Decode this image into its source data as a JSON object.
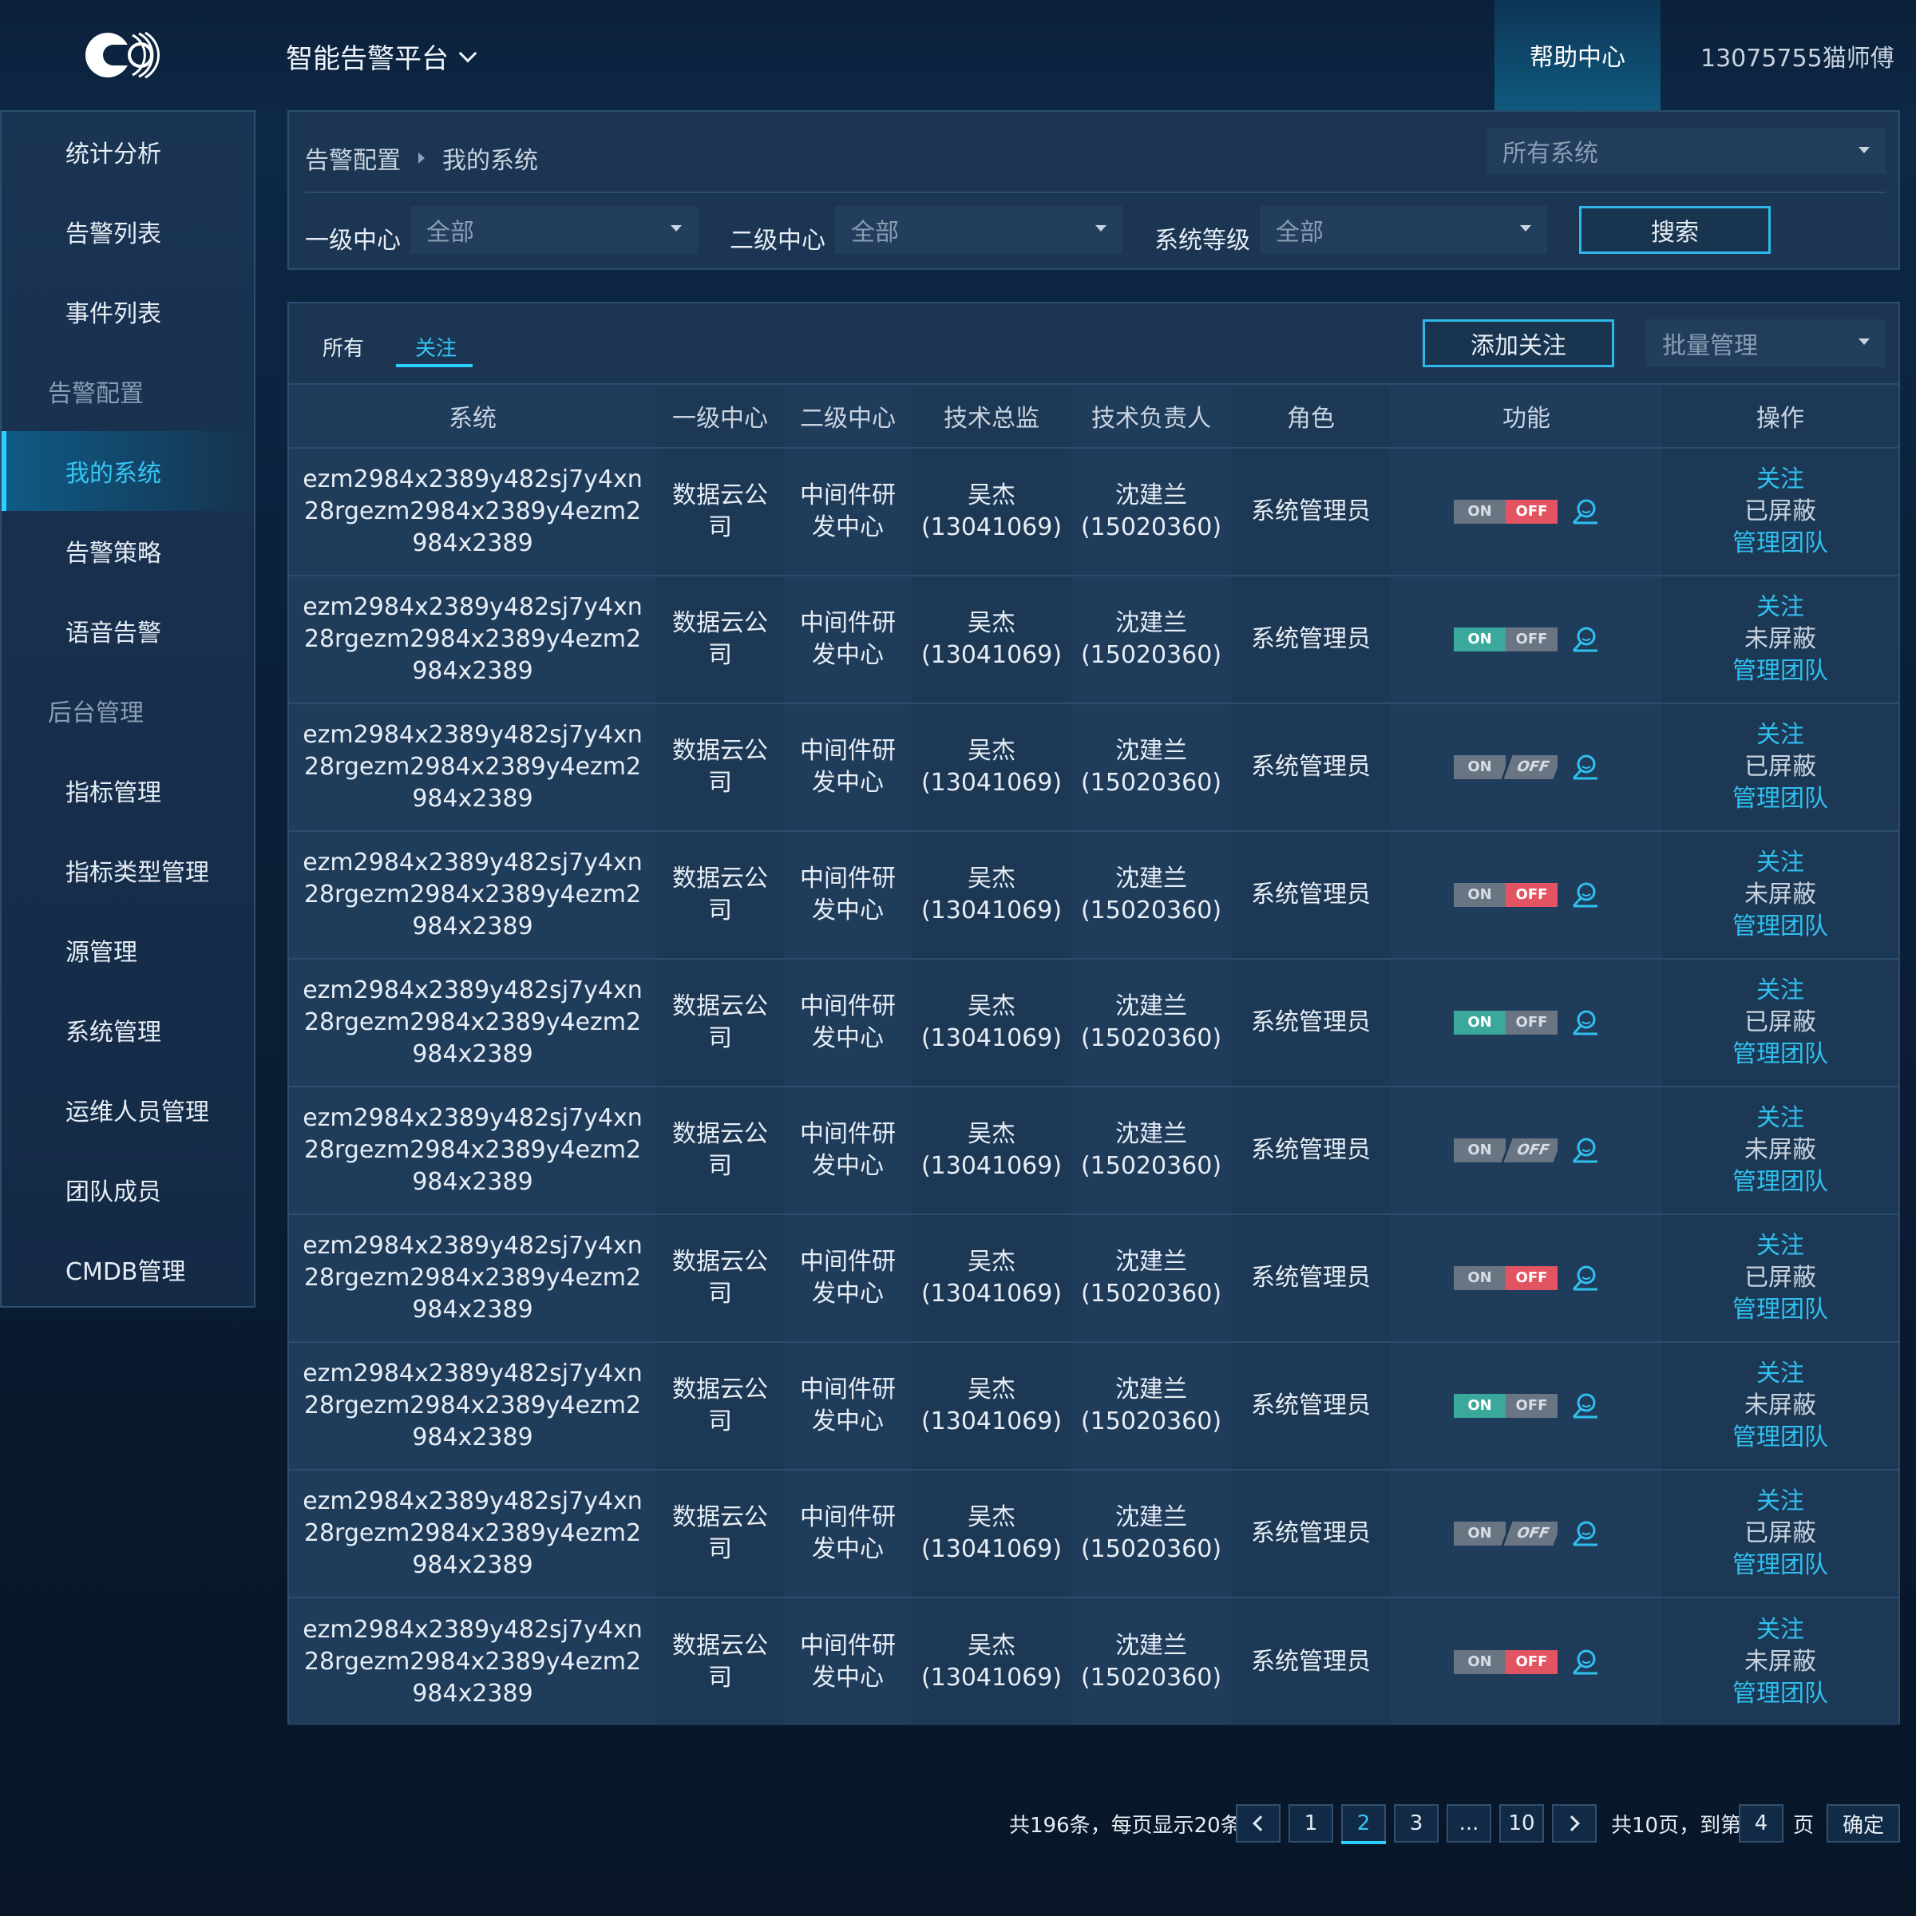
{
  "header": {
    "app_title": "智能告警平台",
    "help_label": "帮助中心",
    "user_label": "13075755猫师傅"
  },
  "sidebar": {
    "items": [
      {
        "label": "统计分析",
        "type": "item"
      },
      {
        "label": "告警列表",
        "type": "item"
      },
      {
        "label": "事件列表",
        "type": "item"
      },
      {
        "label": "告警配置",
        "type": "group"
      },
      {
        "label": "我的系统",
        "type": "item",
        "active": true
      },
      {
        "label": "告警策略",
        "type": "item"
      },
      {
        "label": "语音告警",
        "type": "item"
      },
      {
        "label": "后台管理",
        "type": "group"
      },
      {
        "label": "指标管理",
        "type": "item"
      },
      {
        "label": "指标类型管理",
        "type": "item"
      },
      {
        "label": "源管理",
        "type": "item"
      },
      {
        "label": "系统管理",
        "type": "item"
      },
      {
        "label": "运维人员管理",
        "type": "item"
      },
      {
        "label": "团队成员",
        "type": "item"
      },
      {
        "label": "CMDB管理",
        "type": "item"
      }
    ]
  },
  "breadcrumb": {
    "parent": "告警配置",
    "current": "我的系统"
  },
  "filters": {
    "system_select": "所有系统",
    "level1_label": "一级中心",
    "level1_value": "全部",
    "level2_label": "二级中心",
    "level2_value": "全部",
    "grade_label": "系统等级",
    "grade_value": "全部",
    "search_label": "搜索"
  },
  "tabs": {
    "all": "所有",
    "favorites": "关注"
  },
  "toolbar": {
    "add_label": "添加关注",
    "batch_label": "批量管理"
  },
  "table": {
    "columns": [
      "系统",
      "一级中心",
      "二级中心",
      "技术总监",
      "技术负责人",
      "角色",
      "功能",
      "操作"
    ],
    "rows": [
      {
        "system": "ezm2984x2389y482sj7y4xn28rgezm2984x2389y4ezm2984x2389",
        "l1": "数据云公司",
        "l2": "中间件研发中心",
        "director": "吴杰(13041069)",
        "owner": "沈建兰(15020360)",
        "role": "系统管理员",
        "toggle": "off",
        "op1": "关注",
        "op2": "已屏蔽",
        "op3": "管理团队"
      },
      {
        "system": "ezm2984x2389y482sj7y4xn28rgezm2984x2389y4ezm2984x2389",
        "l1": "数据云公司",
        "l2": "中间件研发中心",
        "director": "吴杰(13041069)",
        "owner": "沈建兰(15020360)",
        "role": "系统管理员",
        "toggle": "on",
        "op1": "关注",
        "op2": "未屏蔽",
        "op3": "管理团队"
      },
      {
        "system": "ezm2984x2389y482sj7y4xn28rgezm2984x2389y4ezm2984x2389",
        "l1": "数据云公司",
        "l2": "中间件研发中心",
        "director": "吴杰(13041069)",
        "owner": "沈建兰(15020360)",
        "role": "系统管理员",
        "toggle": "neutral",
        "op1": "关注",
        "op2": "已屏蔽",
        "op3": "管理团队"
      },
      {
        "system": "ezm2984x2389y482sj7y4xn28rgezm2984x2389y4ezm2984x2389",
        "l1": "数据云公司",
        "l2": "中间件研发中心",
        "director": "吴杰(13041069)",
        "owner": "沈建兰(15020360)",
        "role": "系统管理员",
        "toggle": "off",
        "op1": "关注",
        "op2": "未屏蔽",
        "op3": "管理团队"
      },
      {
        "system": "ezm2984x2389y482sj7y4xn28rgezm2984x2389y4ezm2984x2389",
        "l1": "数据云公司",
        "l2": "中间件研发中心",
        "director": "吴杰(13041069)",
        "owner": "沈建兰(15020360)",
        "role": "系统管理员",
        "toggle": "on",
        "op1": "关注",
        "op2": "已屏蔽",
        "op3": "管理团队"
      },
      {
        "system": "ezm2984x2389y482sj7y4xn28rgezm2984x2389y4ezm2984x2389",
        "l1": "数据云公司",
        "l2": "中间件研发中心",
        "director": "吴杰(13041069)",
        "owner": "沈建兰(15020360)",
        "role": "系统管理员",
        "toggle": "neutral",
        "op1": "关注",
        "op2": "未屏蔽",
        "op3": "管理团队"
      },
      {
        "system": "ezm2984x2389y482sj7y4xn28rgezm2984x2389y4ezm2984x2389",
        "l1": "数据云公司",
        "l2": "中间件研发中心",
        "director": "吴杰(13041069)",
        "owner": "沈建兰(15020360)",
        "role": "系统管理员",
        "toggle": "off",
        "op1": "关注",
        "op2": "已屏蔽",
        "op3": "管理团队"
      },
      {
        "system": "ezm2984x2389y482sj7y4xn28rgezm2984x2389y4ezm2984x2389",
        "l1": "数据云公司",
        "l2": "中间件研发中心",
        "director": "吴杰(13041069)",
        "owner": "沈建兰(15020360)",
        "role": "系统管理员",
        "toggle": "on",
        "op1": "关注",
        "op2": "未屏蔽",
        "op3": "管理团队"
      },
      {
        "system": "ezm2984x2389y482sj7y4xn28rgezm2984x2389y4ezm2984x2389",
        "l1": "数据云公司",
        "l2": "中间件研发中心",
        "director": "吴杰(13041069)",
        "owner": "沈建兰(15020360)",
        "role": "系统管理员",
        "toggle": "neutral",
        "op1": "关注",
        "op2": "已屏蔽",
        "op3": "管理团队"
      },
      {
        "system": "ezm2984x2389y482sj7y4xn28rgezm2984x2389y4ezm2984x2389",
        "l1": "数据云公司",
        "l2": "中间件研发中心",
        "director": "吴杰(13041069)",
        "owner": "沈建兰(15020360)",
        "role": "系统管理员",
        "toggle": "off",
        "op1": "关注",
        "op2": "未屏蔽",
        "op3": "管理团队"
      }
    ],
    "toggle_on_label": "ON",
    "toggle_off_label": "OFF"
  },
  "pagination": {
    "summary": "共196条，每页显示20条",
    "pages": [
      "1",
      "2",
      "3",
      "...",
      "10"
    ],
    "current": "2",
    "total_label": "共10页，到第",
    "goto_value": "4",
    "page_unit": "页",
    "confirm_label": "确定"
  },
  "colors": {
    "accent": "#2ad0ff",
    "link": "#2fc0f0",
    "toggle_on": "#3aa89a",
    "toggle_off": "#e35462"
  }
}
